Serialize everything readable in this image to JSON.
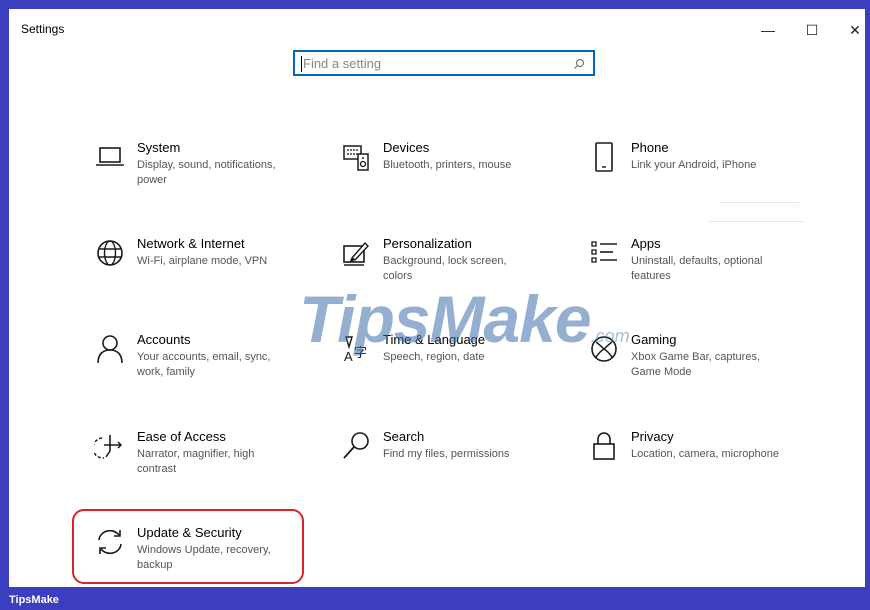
{
  "window": {
    "title": "Settings",
    "controls": {
      "minimize": "—",
      "maximize": "☐",
      "close": "✕"
    }
  },
  "search": {
    "placeholder": "Find a setting",
    "icon": "search-icon"
  },
  "categories": [
    {
      "title": "System",
      "desc": "Display, sound, notifications, power",
      "icon": "laptop-icon"
    },
    {
      "title": "Devices",
      "desc": "Bluetooth, printers, mouse",
      "icon": "keyboard-speaker-icon"
    },
    {
      "title": "Phone",
      "desc": "Link your Android, iPhone",
      "icon": "phone-icon"
    },
    {
      "title": "Network & Internet",
      "desc": "Wi-Fi, airplane mode, VPN",
      "icon": "globe-icon"
    },
    {
      "title": "Personalization",
      "desc": "Background, lock screen, colors",
      "icon": "paint-icon"
    },
    {
      "title": "Apps",
      "desc": "Uninstall, defaults, optional features",
      "icon": "apps-list-icon"
    },
    {
      "title": "Accounts",
      "desc": "Your accounts, email, sync, work, family",
      "icon": "person-icon"
    },
    {
      "title": "Time & Language",
      "desc": "Speech, region, date",
      "icon": "time-language-icon"
    },
    {
      "title": "Gaming",
      "desc": "Xbox Game Bar, captures, Game Mode",
      "icon": "xbox-icon"
    },
    {
      "title": "Ease of Access",
      "desc": "Narrator, magnifier, high contrast",
      "icon": "ease-of-access-icon"
    },
    {
      "title": "Search",
      "desc": "Find my files, permissions",
      "icon": "magnifier-icon"
    },
    {
      "title": "Privacy",
      "desc": "Location, camera, microphone",
      "icon": "lock-icon"
    },
    {
      "title": "Update & Security",
      "desc": "Windows Update, recovery, backup",
      "icon": "sync-icon"
    }
  ],
  "watermark": {
    "brand": "TipsMake",
    "suffix": ".com"
  },
  "footer": {
    "label": "TipsMake"
  },
  "colors": {
    "frame": "#3b3fbf",
    "accent": "#0067c0",
    "highlight": "#d8232a",
    "icon": "#1a1a1a"
  }
}
